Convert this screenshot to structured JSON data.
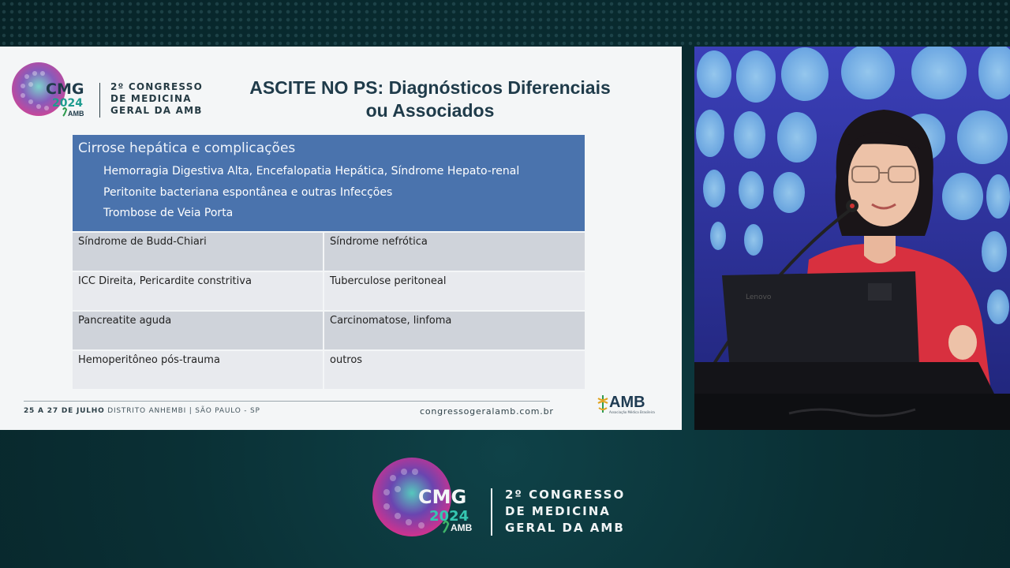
{
  "slide": {
    "logo": {
      "main": "CMG",
      "year": "2024",
      "org": "AMB",
      "title_lines": [
        "2º CONGRESSO",
        "DE MEDICINA",
        "GERAL DA AMB"
      ]
    },
    "title_line1": "ASCITE NO PS: Diagnósticos Diferenciais",
    "title_line2": "ou Associados",
    "highlight_box": {
      "heading": "Cirrose hepática e complicações",
      "items": [
        "Hemorragia Digestiva Alta, Encefalopatia Hepática, Síndrome Hepato-renal",
        "Peritonite bacteriana espontânea e outras Infecções",
        "Trombose de Veia Porta"
      ]
    },
    "table_rows": [
      [
        "Síndrome de Budd-Chiari",
        "Síndrome nefrótica"
      ],
      [
        "ICC Direita, Pericardite constritiva",
        "Tuberculose peritoneal"
      ],
      [
        "Pancreatite aguda",
        "Carcinomatose, linfoma"
      ],
      [
        "Hemoperitôneo pós-trauma",
        "outros"
      ]
    ],
    "footer": {
      "dates": "25 A 27 DE JULHO",
      "venue": "DISTRITO ANHEMBI | SÃO PAULO - SP",
      "website": "congressogeralamb.com.br",
      "amb_logo": "AMB",
      "amb_tagline": "Associação Médica Brasileira"
    }
  },
  "branding": {
    "main": "CMG",
    "year": "2024",
    "org": "AMB",
    "title_lines": [
      "2º CONGRESSO",
      "DE MEDICINA",
      "GERAL DA AMB"
    ]
  },
  "camera": {
    "laptop_brand": "Lenovo"
  },
  "colors": {
    "background": "#0a3035",
    "slide_blue": "#4a73ad",
    "row_dark": "#cfd3da",
    "row_light": "#e8eaee",
    "shirt_red": "#d8303f"
  }
}
